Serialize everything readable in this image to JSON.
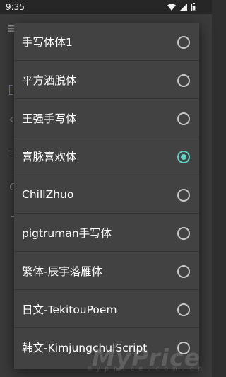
{
  "status_bar": {
    "time": "9:35",
    "icons": [
      "wifi-icon",
      "signal-icon",
      "battery-icon"
    ]
  },
  "dialog": {
    "options": [
      {
        "label": "手写体体1",
        "selected": false
      },
      {
        "label": "平方洒脱体",
        "selected": false
      },
      {
        "label": "王强手写体",
        "selected": false
      },
      {
        "label": "喜脉喜欢体",
        "selected": true
      },
      {
        "label": "ChillZhuo",
        "selected": false
      },
      {
        "label": "pigtruman手写体",
        "selected": false
      },
      {
        "label": "繁体-辰宇落雁体",
        "selected": false
      },
      {
        "label": "日文-TekitouPoem",
        "selected": false
      },
      {
        "label": "韩文-KimjungchulScript",
        "selected": false
      }
    ]
  },
  "watermark": {
    "main": "MyPrice",
    "sub": "myprice.com.cn"
  },
  "colors": {
    "dialog_bg": "#424242",
    "accent": "#5fd1c1",
    "text": "#ffffff"
  }
}
